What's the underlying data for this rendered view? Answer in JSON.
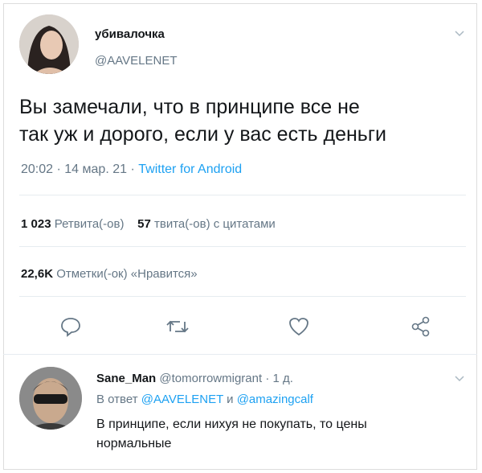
{
  "tweet": {
    "author_name": "убивалочка",
    "author_handle": "@AAVELENET",
    "text_line1": "Вы замечали, что в принципе все не",
    "text_line2": "так уж и дорого, если у вас есть деньги",
    "time": "20:02",
    "date": "14 мар. 21",
    "source": "Twitter for Android",
    "retweets_count": "1 023",
    "retweets_label": "Ретвита(-ов)",
    "quotes_count": "57",
    "quotes_label": "твита(-ов) с цитатами",
    "likes_count": "22,6K",
    "likes_label": "Отметки(-ок) «Нравится»"
  },
  "actions": [
    "reply-icon",
    "retweet-icon",
    "like-icon",
    "share-icon"
  ],
  "reply": {
    "author_name": "Sane_Man",
    "author_handle": "@tomorrowmigrant",
    "age": "1 д.",
    "replying_prefix": "В ответ",
    "replying_to1": "@AAVELENET",
    "replying_and": "и",
    "replying_to2": "@amazingcalf",
    "text_line1": "В принципе, если нихуя не покупать, то цены",
    "text_line2": "нормальные"
  },
  "colors": {
    "accent": "#1da1f2",
    "secondary": "#657786",
    "divider": "#e6ecf0"
  }
}
